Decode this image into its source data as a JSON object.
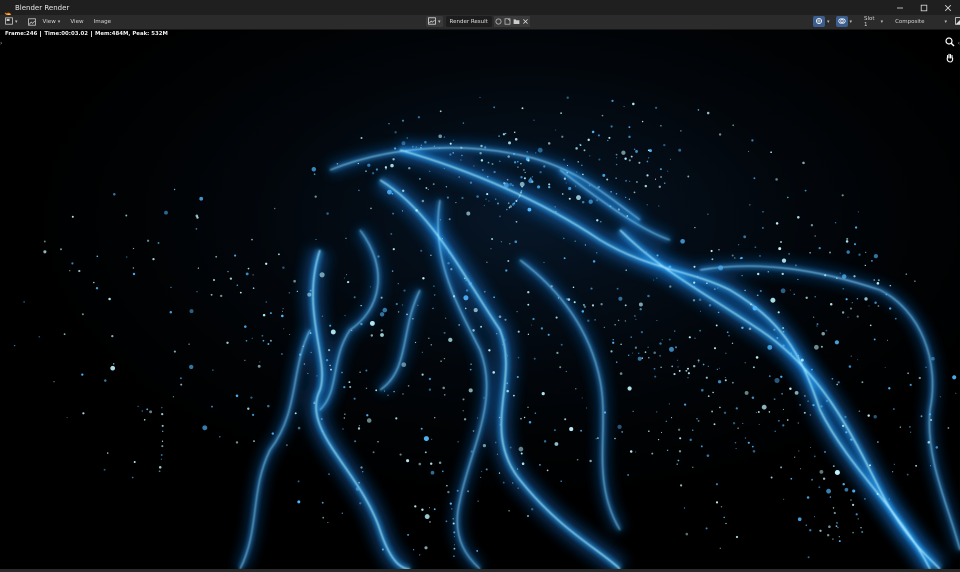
{
  "window": {
    "title": "Blender Render",
    "minimize_glyph": "—",
    "maximize_glyph": "☐",
    "close_glyph": "✕"
  },
  "header": {
    "menus": [
      {
        "label": "View",
        "has_dropdown": true
      },
      {
        "label": "View",
        "has_dropdown": false
      },
      {
        "label": "Image",
        "has_dropdown": false
      }
    ],
    "image_name": "Render Result",
    "slot": "Slot 1",
    "layer": "Composite"
  },
  "stats": {
    "frame": "Frame:246",
    "time": "Time:00:03.02",
    "memory": "Mem:484M, Peak: 532M"
  },
  "colors": {
    "accent": "#3c5e8e",
    "particle_core": "#bff6ff",
    "particle_glow": "#1a8cff",
    "titlebar": "#1f1f1f",
    "header": "#2b2b2b"
  },
  "icons": [
    "blender-logo-icon",
    "editor-type-icon",
    "image-mode-icon",
    "browse-image-icon",
    "fake-user-icon",
    "new-image-icon",
    "open-image-icon",
    "unlink-icon",
    "gizmo-icon",
    "overlay-icon",
    "display-channels-icon",
    "zoom-icon",
    "hand-pan-icon"
  ]
}
